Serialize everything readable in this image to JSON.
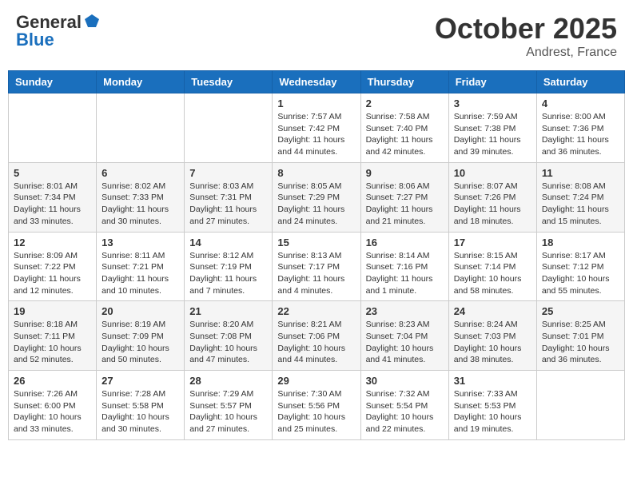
{
  "logo": {
    "general": "General",
    "blue": "Blue"
  },
  "header": {
    "month": "October 2025",
    "location": "Andrest, France"
  },
  "days": [
    "Sunday",
    "Monday",
    "Tuesday",
    "Wednesday",
    "Thursday",
    "Friday",
    "Saturday"
  ],
  "weeks": [
    [
      {
        "day": "",
        "sunrise": "",
        "sunset": "",
        "daylight": ""
      },
      {
        "day": "",
        "sunrise": "",
        "sunset": "",
        "daylight": ""
      },
      {
        "day": "",
        "sunrise": "",
        "sunset": "",
        "daylight": ""
      },
      {
        "day": "1",
        "sunrise": "Sunrise: 7:57 AM",
        "sunset": "Sunset: 7:42 PM",
        "daylight": "Daylight: 11 hours and 44 minutes."
      },
      {
        "day": "2",
        "sunrise": "Sunrise: 7:58 AM",
        "sunset": "Sunset: 7:40 PM",
        "daylight": "Daylight: 11 hours and 42 minutes."
      },
      {
        "day": "3",
        "sunrise": "Sunrise: 7:59 AM",
        "sunset": "Sunset: 7:38 PM",
        "daylight": "Daylight: 11 hours and 39 minutes."
      },
      {
        "day": "4",
        "sunrise": "Sunrise: 8:00 AM",
        "sunset": "Sunset: 7:36 PM",
        "daylight": "Daylight: 11 hours and 36 minutes."
      }
    ],
    [
      {
        "day": "5",
        "sunrise": "Sunrise: 8:01 AM",
        "sunset": "Sunset: 7:34 PM",
        "daylight": "Daylight: 11 hours and 33 minutes."
      },
      {
        "day": "6",
        "sunrise": "Sunrise: 8:02 AM",
        "sunset": "Sunset: 7:33 PM",
        "daylight": "Daylight: 11 hours and 30 minutes."
      },
      {
        "day": "7",
        "sunrise": "Sunrise: 8:03 AM",
        "sunset": "Sunset: 7:31 PM",
        "daylight": "Daylight: 11 hours and 27 minutes."
      },
      {
        "day": "8",
        "sunrise": "Sunrise: 8:05 AM",
        "sunset": "Sunset: 7:29 PM",
        "daylight": "Daylight: 11 hours and 24 minutes."
      },
      {
        "day": "9",
        "sunrise": "Sunrise: 8:06 AM",
        "sunset": "Sunset: 7:27 PM",
        "daylight": "Daylight: 11 hours and 21 minutes."
      },
      {
        "day": "10",
        "sunrise": "Sunrise: 8:07 AM",
        "sunset": "Sunset: 7:26 PM",
        "daylight": "Daylight: 11 hours and 18 minutes."
      },
      {
        "day": "11",
        "sunrise": "Sunrise: 8:08 AM",
        "sunset": "Sunset: 7:24 PM",
        "daylight": "Daylight: 11 hours and 15 minutes."
      }
    ],
    [
      {
        "day": "12",
        "sunrise": "Sunrise: 8:09 AM",
        "sunset": "Sunset: 7:22 PM",
        "daylight": "Daylight: 11 hours and 12 minutes."
      },
      {
        "day": "13",
        "sunrise": "Sunrise: 8:11 AM",
        "sunset": "Sunset: 7:21 PM",
        "daylight": "Daylight: 11 hours and 10 minutes."
      },
      {
        "day": "14",
        "sunrise": "Sunrise: 8:12 AM",
        "sunset": "Sunset: 7:19 PM",
        "daylight": "Daylight: 11 hours and 7 minutes."
      },
      {
        "day": "15",
        "sunrise": "Sunrise: 8:13 AM",
        "sunset": "Sunset: 7:17 PM",
        "daylight": "Daylight: 11 hours and 4 minutes."
      },
      {
        "day": "16",
        "sunrise": "Sunrise: 8:14 AM",
        "sunset": "Sunset: 7:16 PM",
        "daylight": "Daylight: 11 hours and 1 minute."
      },
      {
        "day": "17",
        "sunrise": "Sunrise: 8:15 AM",
        "sunset": "Sunset: 7:14 PM",
        "daylight": "Daylight: 10 hours and 58 minutes."
      },
      {
        "day": "18",
        "sunrise": "Sunrise: 8:17 AM",
        "sunset": "Sunset: 7:12 PM",
        "daylight": "Daylight: 10 hours and 55 minutes."
      }
    ],
    [
      {
        "day": "19",
        "sunrise": "Sunrise: 8:18 AM",
        "sunset": "Sunset: 7:11 PM",
        "daylight": "Daylight: 10 hours and 52 minutes."
      },
      {
        "day": "20",
        "sunrise": "Sunrise: 8:19 AM",
        "sunset": "Sunset: 7:09 PM",
        "daylight": "Daylight: 10 hours and 50 minutes."
      },
      {
        "day": "21",
        "sunrise": "Sunrise: 8:20 AM",
        "sunset": "Sunset: 7:08 PM",
        "daylight": "Daylight: 10 hours and 47 minutes."
      },
      {
        "day": "22",
        "sunrise": "Sunrise: 8:21 AM",
        "sunset": "Sunset: 7:06 PM",
        "daylight": "Daylight: 10 hours and 44 minutes."
      },
      {
        "day": "23",
        "sunrise": "Sunrise: 8:23 AM",
        "sunset": "Sunset: 7:04 PM",
        "daylight": "Daylight: 10 hours and 41 minutes."
      },
      {
        "day": "24",
        "sunrise": "Sunrise: 8:24 AM",
        "sunset": "Sunset: 7:03 PM",
        "daylight": "Daylight: 10 hours and 38 minutes."
      },
      {
        "day": "25",
        "sunrise": "Sunrise: 8:25 AM",
        "sunset": "Sunset: 7:01 PM",
        "daylight": "Daylight: 10 hours and 36 minutes."
      }
    ],
    [
      {
        "day": "26",
        "sunrise": "Sunrise: 7:26 AM",
        "sunset": "Sunset: 6:00 PM",
        "daylight": "Daylight: 10 hours and 33 minutes."
      },
      {
        "day": "27",
        "sunrise": "Sunrise: 7:28 AM",
        "sunset": "Sunset: 5:58 PM",
        "daylight": "Daylight: 10 hours and 30 minutes."
      },
      {
        "day": "28",
        "sunrise": "Sunrise: 7:29 AM",
        "sunset": "Sunset: 5:57 PM",
        "daylight": "Daylight: 10 hours and 27 minutes."
      },
      {
        "day": "29",
        "sunrise": "Sunrise: 7:30 AM",
        "sunset": "Sunset: 5:56 PM",
        "daylight": "Daylight: 10 hours and 25 minutes."
      },
      {
        "day": "30",
        "sunrise": "Sunrise: 7:32 AM",
        "sunset": "Sunset: 5:54 PM",
        "daylight": "Daylight: 10 hours and 22 minutes."
      },
      {
        "day": "31",
        "sunrise": "Sunrise: 7:33 AM",
        "sunset": "Sunset: 5:53 PM",
        "daylight": "Daylight: 10 hours and 19 minutes."
      },
      {
        "day": "",
        "sunrise": "",
        "sunset": "",
        "daylight": ""
      }
    ]
  ]
}
